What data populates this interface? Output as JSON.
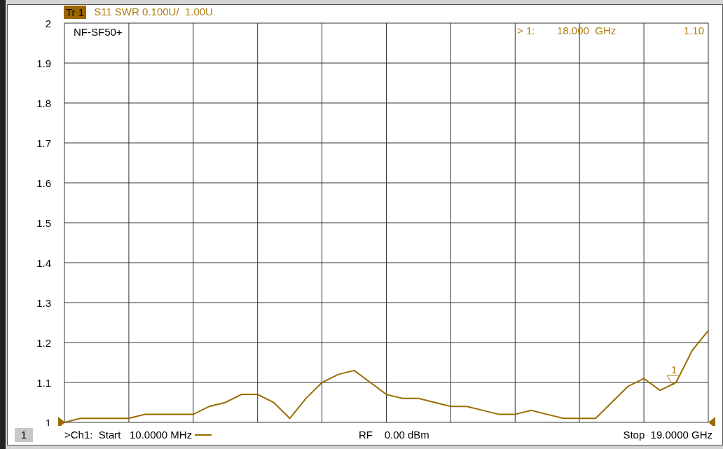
{
  "trace": {
    "badge": "Tr 1",
    "title": "S11 SWR 0.100U/  1.00U"
  },
  "annotation": "NF-SF50+",
  "marker_readout": {
    "label": "> 1:",
    "frequency": "18.000  GHz",
    "value": "1.10"
  },
  "marker_flag": "1",
  "chart_data": {
    "type": "line",
    "ylim": [
      1,
      2
    ],
    "grid": true,
    "categories": [
      null,
      null,
      null,
      null,
      null,
      null,
      null,
      null,
      null,
      null,
      null,
      null,
      null,
      null,
      null,
      null,
      null,
      null,
      null,
      null,
      null,
      null,
      null,
      null,
      null,
      null,
      null,
      null,
      null,
      null,
      null,
      null,
      null,
      null,
      null,
      null,
      null,
      null,
      null,
      null,
      null
    ],
    "series": [
      {
        "color": "#9b6b00",
        "values": [
          1.0,
          1.01,
          1.01,
          1.01,
          1.01,
          1.02,
          1.02,
          1.02,
          1.02,
          1.04,
          1.05,
          1.07,
          1.07,
          1.05,
          1.01,
          1.06,
          1.1,
          1.12,
          1.13,
          1.1,
          1.07,
          1.06,
          1.06,
          1.05,
          1.04,
          1.04,
          1.03,
          1.02,
          1.02,
          1.03,
          1.02,
          1.01,
          1.01,
          1.01,
          1.05,
          1.09,
          1.11,
          1.08,
          1.1,
          1.18,
          1.23
        ]
      }
    ],
    "yticks": [
      2,
      1.9,
      1.8,
      1.7,
      1.6,
      1.5,
      1.4,
      1.3,
      1.2,
      1.1,
      1
    ]
  },
  "footer": {
    "channel": "1",
    "start": ">Ch1:  Start   10.0000 MHz",
    "power": "RF    0.00 dBm",
    "stop": "Stop  19.0000 GHz"
  }
}
